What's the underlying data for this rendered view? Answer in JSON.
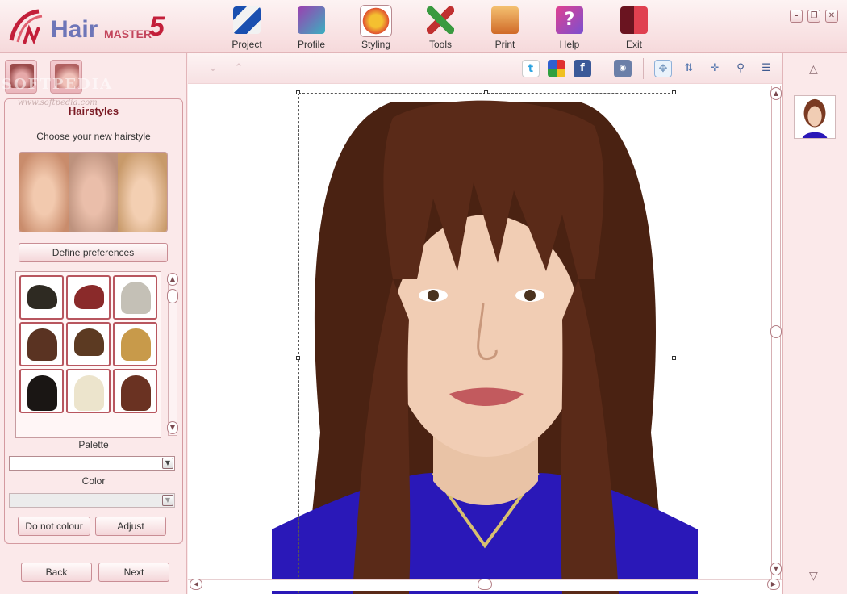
{
  "app": {
    "logo_hair": "Hair",
    "logo_master": "MASTER",
    "logo_version": "5"
  },
  "toolbar": [
    {
      "label": "Project",
      "icon": "project-icon",
      "color": "#2a6bd1"
    },
    {
      "label": "Profile",
      "icon": "profile-icon",
      "color": "#9c3fb0"
    },
    {
      "label": "Styling",
      "icon": "styling-icon",
      "color": "#e0a020",
      "active": true
    },
    {
      "label": "Tools",
      "icon": "tools-icon",
      "color": "#3a9a40"
    },
    {
      "label": "Print",
      "icon": "print-icon",
      "color": "#c87828"
    },
    {
      "label": "Help",
      "icon": "help-icon",
      "color": "#c83870"
    },
    {
      "label": "Exit",
      "icon": "exit-icon",
      "color": "#c02030"
    }
  ],
  "window": {
    "minimize": "–",
    "maximize": "❐",
    "close": "✕"
  },
  "watermark": {
    "text": "SOFTPEDIA",
    "url": "www.softpedia.com"
  },
  "panel": {
    "title": "Hairstyles",
    "subtitle": "Choose your new hairstyle",
    "define_btn": "Define preferences",
    "palette_label": "Palette",
    "palette_value": "",
    "color_label": "Color",
    "color_value": "",
    "do_not_colour_btn": "Do not colour",
    "adjust_btn": "Adjust",
    "back_btn": "Back",
    "next_btn": "Next"
  },
  "hairstyles": [
    {
      "name": "hairstyle-spiky-dark",
      "color": "#2e2a22"
    },
    {
      "name": "hairstyle-spiky-red",
      "color": "#8a2a2a"
    },
    {
      "name": "hairstyle-bob-grey",
      "color": "#c4c0b6"
    },
    {
      "name": "hairstyle-bob-brown",
      "color": "#5a3322"
    },
    {
      "name": "hairstyle-short-brown",
      "color": "#5c3a22"
    },
    {
      "name": "hairstyle-wavy-blonde",
      "color": "#c89a4a"
    },
    {
      "name": "hairstyle-long-black",
      "color": "#1a1614"
    },
    {
      "name": "hairstyle-long-platinum",
      "color": "#ece4cc"
    },
    {
      "name": "hairstyle-long-auburn",
      "color": "#6a3222"
    }
  ],
  "canvas_toolbar": [
    "undo-icon",
    "redo-icon",
    "twitter-icon",
    "picasa-icon",
    "facebook-icon",
    "camera-icon",
    "move-icon",
    "rotate-icon",
    "crosshair-icon",
    "zoom-icon",
    "menu-icon"
  ],
  "colors": {
    "accent": "#c31f3a",
    "panel_bg": "#fbe9ea",
    "border": "#d49aa0",
    "hair": "#5a2a18",
    "dress": "#2a18b8"
  }
}
